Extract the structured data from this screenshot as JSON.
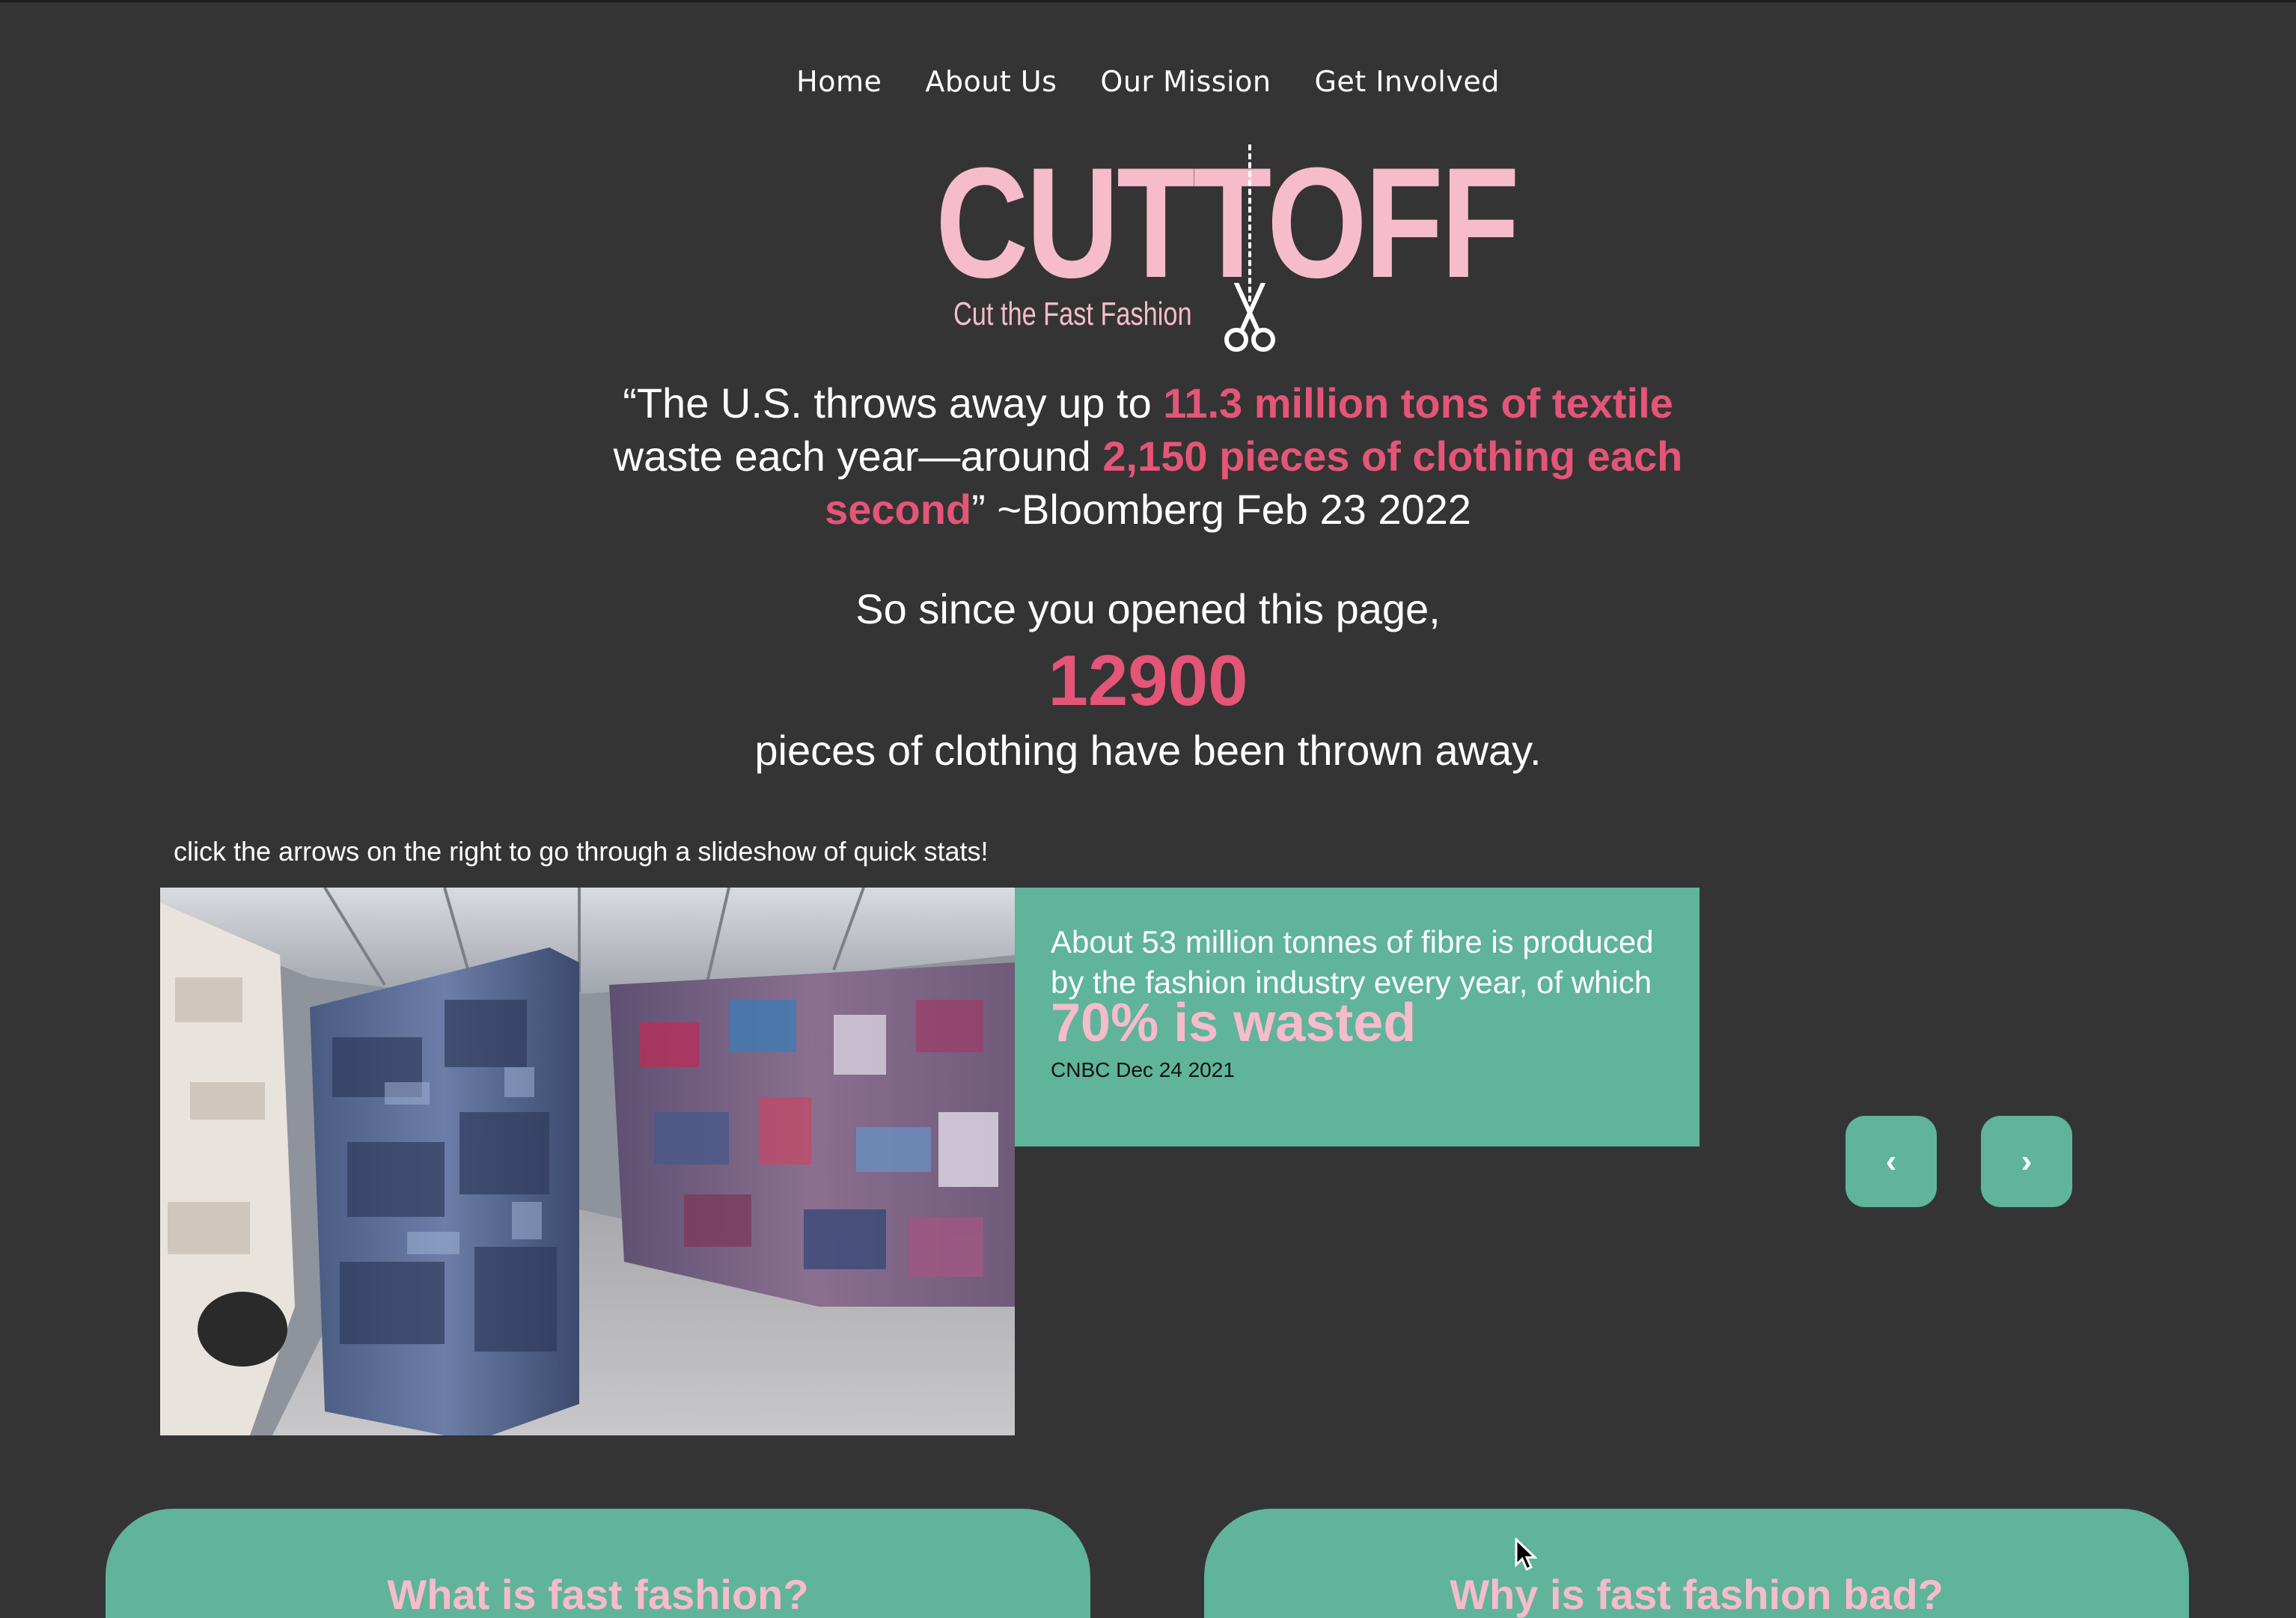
{
  "nav": {
    "items": [
      {
        "label": "Home"
      },
      {
        "label": "About Us"
      },
      {
        "label": "Our Mission"
      },
      {
        "label": "Get Involved"
      }
    ]
  },
  "logo": {
    "wordmark": "CUTTOFF",
    "tagline": "Cut the Fast Fashion",
    "icon": "scissors-icon",
    "color": "#f6bccb"
  },
  "quote": {
    "part1": "“The U.S. throws away up to ",
    "highlight1": "11.3 million tons of textile",
    "part2": " waste each year—around ",
    "highlight2": "2,150 pieces of clothing each second",
    "part3": "” ~Bloomberg Feb 23 2022"
  },
  "counter": {
    "lead": "So since you opened this page,",
    "value": "12900",
    "trail": "pieces of clothing have been thrown away."
  },
  "slideshow": {
    "hint": "click the arrows on the right to go through a slideshow of quick stats!",
    "stat_text": "About 53 million tonnes of fibre is produced by the fashion industry every year, of which ",
    "stat_highlight": "70% is wasted",
    "stat_source": "CNBC Dec 24 2021",
    "prev_label": "‹",
    "next_label": "›"
  },
  "cards": {
    "left_title": "What is fast fashion?",
    "right_title": "Why is fast fashion bad?"
  },
  "colors": {
    "background": "#343434",
    "accent_pink": "#e45577",
    "light_pink": "#f6bccb",
    "teal": "#5fb49a"
  }
}
